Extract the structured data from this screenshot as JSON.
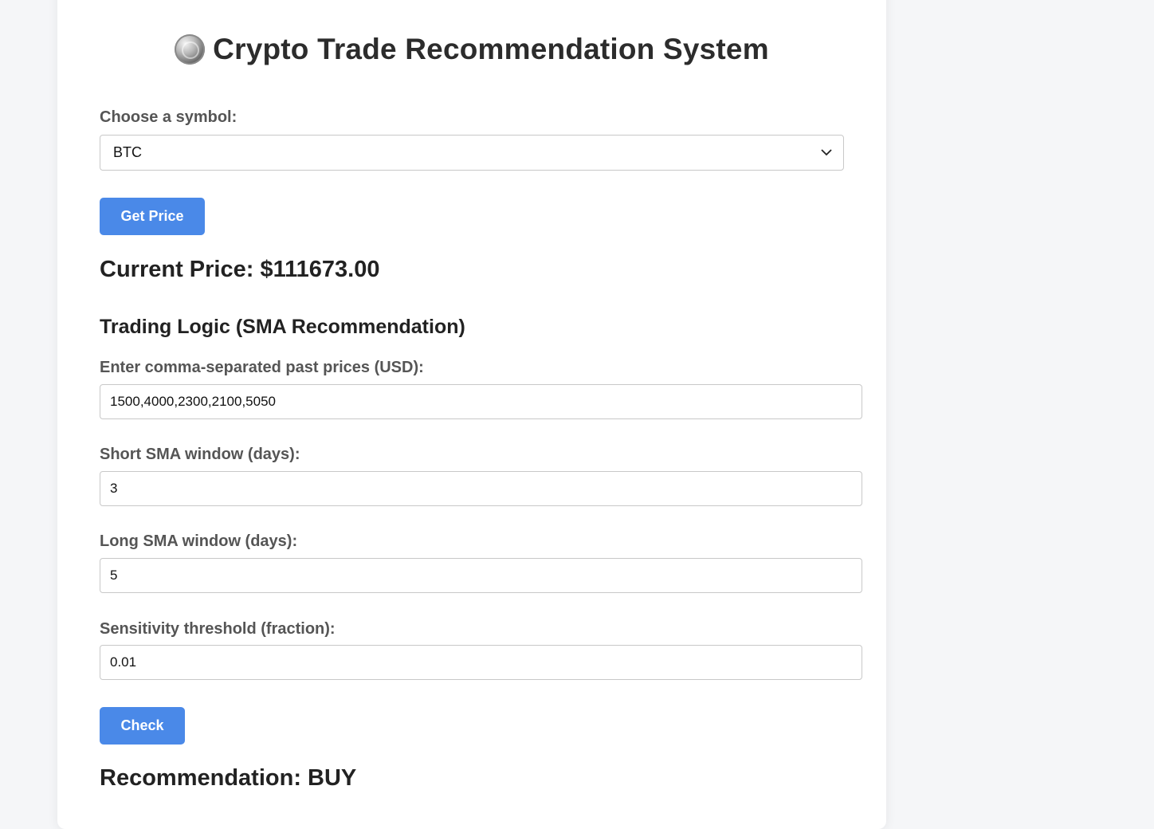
{
  "title": "Crypto Trade Recommendation System",
  "title_icon": "coin-icon",
  "symbol": {
    "label": "Choose a symbol:",
    "selected": "BTC"
  },
  "get_price_button": "Get Price",
  "current_price": "Current Price: $111673.00",
  "trading_logic": {
    "heading": "Trading Logic (SMA Recommendation)",
    "prices_label": "Enter comma-separated past prices (USD):",
    "prices_value": "1500,4000,2300,2100,5050",
    "short_label": "Short SMA window (days):",
    "short_value": "3",
    "long_label": "Long SMA window (days):",
    "long_value": "5",
    "threshold_label": "Sensitivity threshold (fraction):",
    "threshold_value": "0.01",
    "check_button": "Check"
  },
  "recommendation": "Recommendation: BUY",
  "colors": {
    "accent": "#4a89e8",
    "background": "#f5f6f8",
    "card": "#ffffff"
  }
}
